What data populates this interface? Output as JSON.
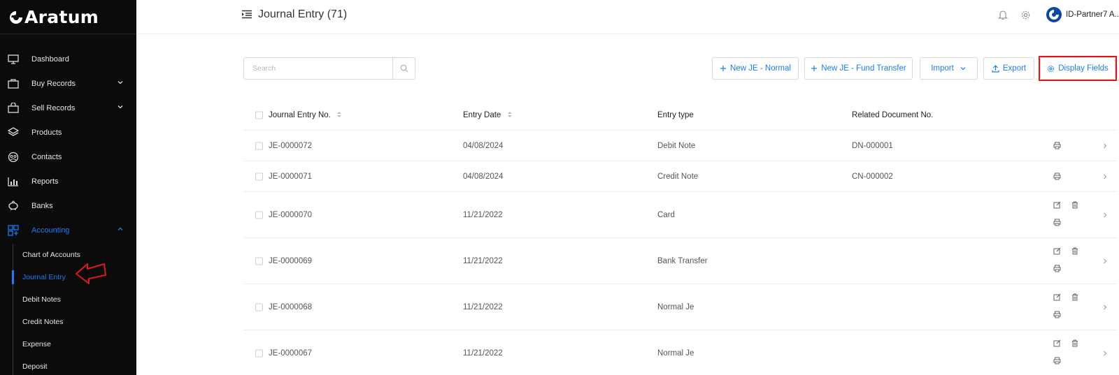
{
  "app": {
    "brand": "Aratum"
  },
  "sidebar": {
    "items": [
      {
        "label": "Dashboard",
        "icon": "monitor-icon",
        "has_children": false
      },
      {
        "label": "Buy Records",
        "icon": "briefcase-icon",
        "has_children": true
      },
      {
        "label": "Sell Records",
        "icon": "shopping-bag-icon",
        "has_children": true
      },
      {
        "label": "Products",
        "icon": "layers-icon",
        "has_children": false
      },
      {
        "label": "Contacts",
        "icon": "contacts-icon",
        "has_children": false
      },
      {
        "label": "Reports",
        "icon": "bar-chart-icon",
        "has_children": false
      },
      {
        "label": "Banks",
        "icon": "piggy-bank-icon",
        "has_children": false
      },
      {
        "label": "Accounting",
        "icon": "accounting-icon",
        "has_children": true,
        "expanded": true,
        "active": true
      }
    ],
    "submenu": [
      {
        "label": "Chart of Accounts"
      },
      {
        "label": "Journal Entry",
        "active": true
      },
      {
        "label": "Debit Notes"
      },
      {
        "label": "Credit Notes"
      },
      {
        "label": "Expense"
      },
      {
        "label": "Deposit"
      }
    ]
  },
  "header": {
    "title": "Journal Entry (71)",
    "user_name": "ID-Partner7 A.."
  },
  "toolbar": {
    "search_placeholder": "Search",
    "new_je_normal": "New JE - Normal",
    "new_je_fund_transfer": "New JE - Fund Transfer",
    "import": "Import",
    "export": "Export",
    "display_fields": "Display Fields"
  },
  "table": {
    "columns": [
      "Journal Entry No.",
      "Entry Date",
      "Entry type",
      "Related Document No."
    ],
    "rows": [
      {
        "no": "JE-0000072",
        "date": "04/08/2024",
        "type": "Debit Note",
        "doc": "DN-000001",
        "editable": false
      },
      {
        "no": "JE-0000071",
        "date": "04/08/2024",
        "type": "Credit Note",
        "doc": "CN-000002",
        "editable": false
      },
      {
        "no": "JE-0000070",
        "date": "11/21/2022",
        "type": "Card",
        "doc": "",
        "editable": true
      },
      {
        "no": "JE-0000069",
        "date": "11/21/2022",
        "type": "Bank Transfer",
        "doc": "",
        "editable": true
      },
      {
        "no": "JE-0000068",
        "date": "11/21/2022",
        "type": "Normal Je",
        "doc": "",
        "editable": true
      },
      {
        "no": "JE-0000067",
        "date": "11/21/2022",
        "type": "Normal Je",
        "doc": "",
        "editable": true
      }
    ]
  },
  "colors": {
    "accent": "#1c7cf4",
    "sidebar_bg": "#0b0b0b",
    "highlight": "#e0171f"
  }
}
